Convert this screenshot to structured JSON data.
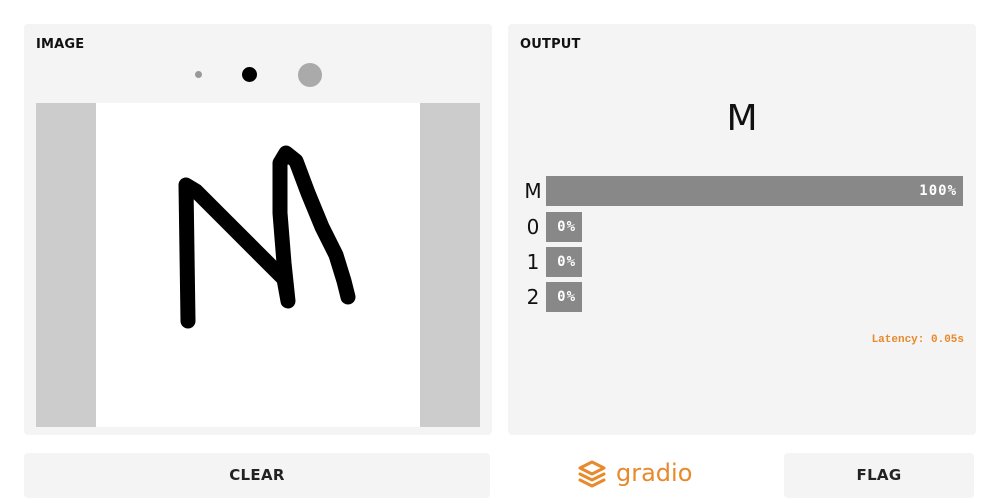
{
  "input": {
    "title": "IMAGE"
  },
  "output": {
    "title": "OUTPUT",
    "prediction": "M",
    "confidences": [
      {
        "label": "M",
        "value": 1.0,
        "text": "100%"
      },
      {
        "label": "0",
        "value": 0.0,
        "text": "0%"
      },
      {
        "label": "1",
        "value": 0.0,
        "text": "0%"
      },
      {
        "label": "2",
        "value": 0.0,
        "text": "0%"
      }
    ],
    "latency": "Latency: 0.05s"
  },
  "buttons": {
    "clear": "CLEAR",
    "flag": "FLAG"
  },
  "brand": {
    "name": "gradio",
    "color": "#e8892b"
  },
  "colors": {
    "panel": "#f4f4f4",
    "bar": "#888888",
    "accent": "#e8892b"
  }
}
